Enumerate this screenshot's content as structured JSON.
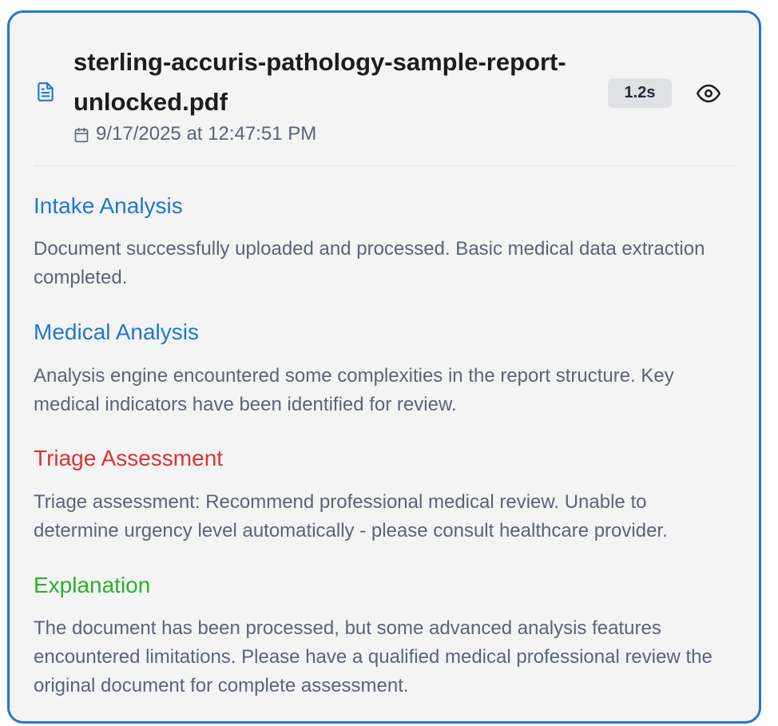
{
  "file": {
    "name": "sterling-accuris-pathology-sample-report-unlocked.pdf",
    "date": "9/17/2025 at 12:47:51 PM",
    "duration": "1.2s",
    "icon": "file-text-icon"
  },
  "sections": [
    {
      "title": "Intake Analysis",
      "color": "#1f78d1",
      "body": "Document successfully uploaded and processed. Basic medical data extraction completed."
    },
    {
      "title": "Medical Analysis",
      "color": "#1f78d1",
      "body": "Analysis engine encountered some complexities in the report structure. Key medical indicators have been identified for review."
    },
    {
      "title": "Triage Assessment",
      "color": "#dc3232",
      "body": "Triage assessment: Recommend professional medical review. Unable to determine urgency level automatically - please consult healthcare provider."
    },
    {
      "title": "Explanation",
      "color": "#2bb02b",
      "body": "The document has been processed, but some advanced analysis features encountered limitations. Please have a qualified medical professional review the original document for complete assessment."
    }
  ]
}
